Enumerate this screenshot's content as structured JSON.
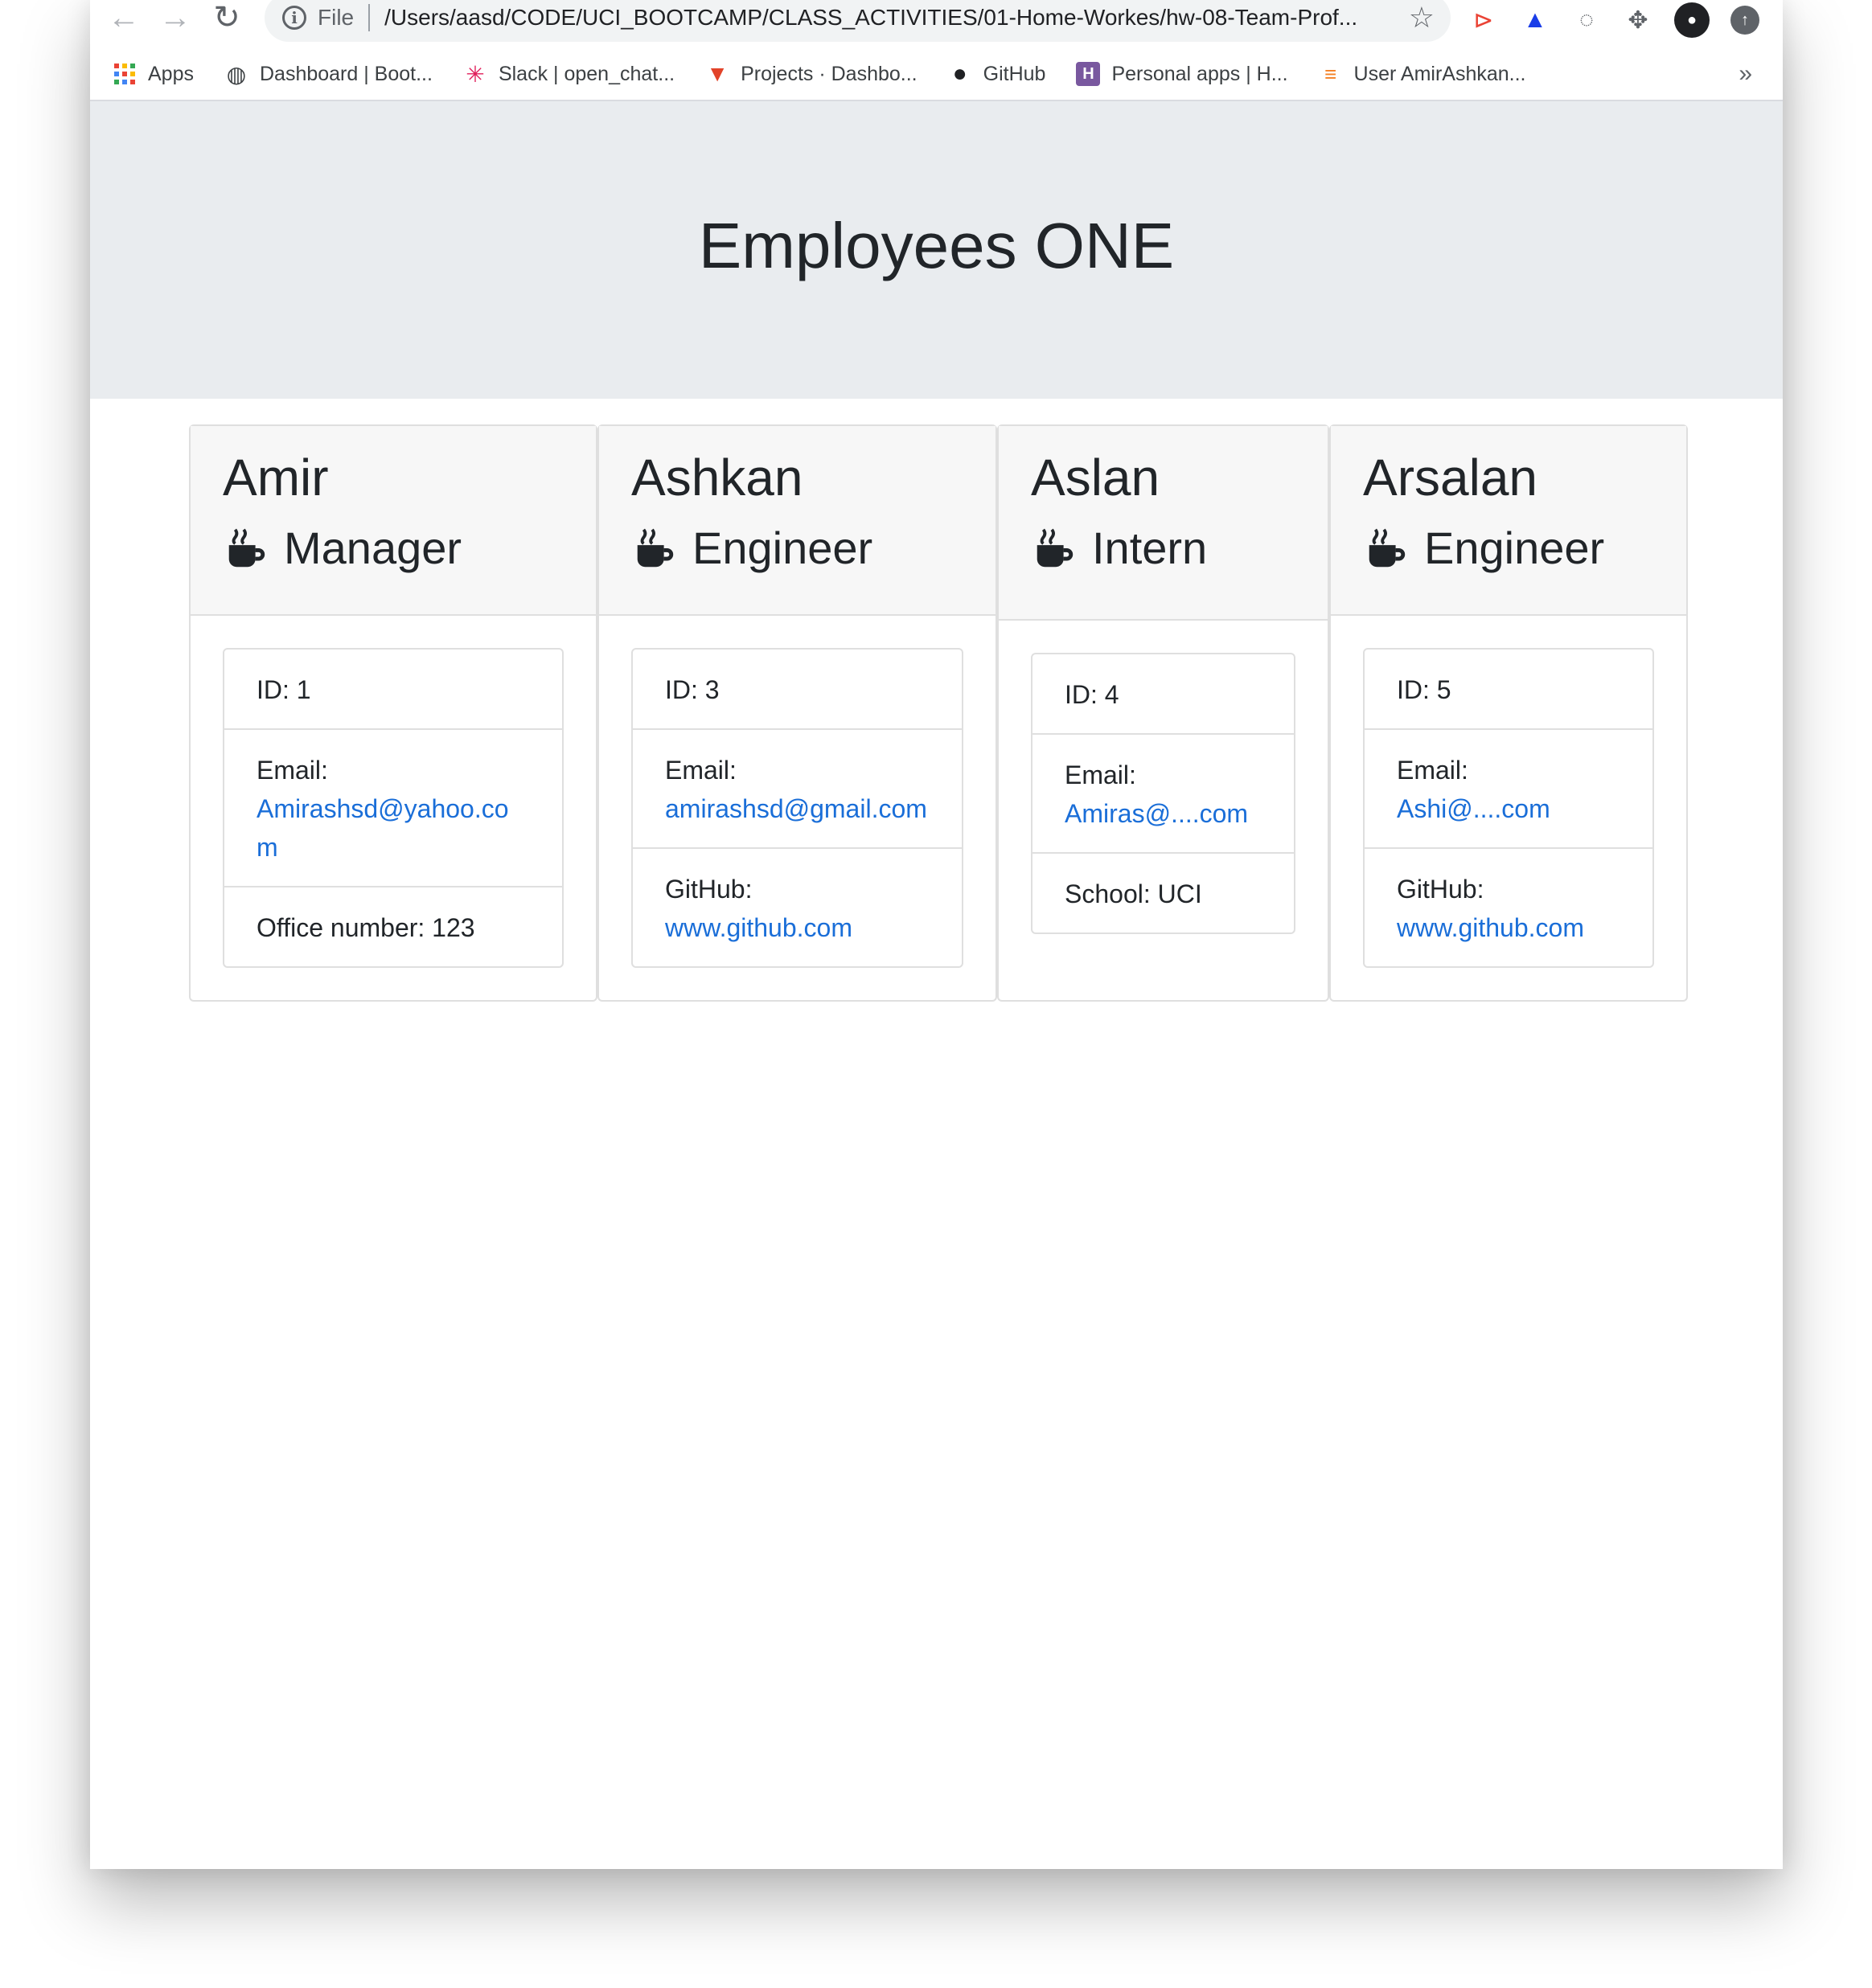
{
  "browser": {
    "file_label": "File",
    "url": "/Users/aasd/CODE/UCI_BOOTCAMP/CLASS_ACTIVITIES/01-Home-Workes/hw-08-Team-Prof...",
    "bookmarks": [
      {
        "label": "Apps",
        "icon": "apps-grid-icon"
      },
      {
        "label": "Dashboard | Boot...",
        "icon": "globe-icon"
      },
      {
        "label": "Slack | open_chat...",
        "icon": "slack-icon"
      },
      {
        "label": "Projects · Dashbo...",
        "icon": "gitlab-icon"
      },
      {
        "label": "GitHub",
        "icon": "github-icon"
      },
      {
        "label": "Personal apps | H...",
        "icon": "heroku-icon"
      },
      {
        "label": "User AmirAshkan...",
        "icon": "stackoverflow-icon"
      }
    ],
    "more_bookmarks": "»"
  },
  "page": {
    "title": "Employees ONE"
  },
  "employees": [
    {
      "name": "Amir",
      "role": "Manager",
      "id_text": "ID: 1",
      "email_label": "Email:",
      "email": "Amirashsd@yahoo.com",
      "extra_label": "Office number: 123",
      "extra_value": ""
    },
    {
      "name": "Ashkan",
      "role": "Engineer",
      "id_text": "ID: 3",
      "email_label": "Email:",
      "email": "amirashsd@gmail.com",
      "extra_label": "GitHub:",
      "extra_value": "www.github.com"
    },
    {
      "name": "Aslan",
      "role": "Intern",
      "id_text": "ID: 4",
      "email_label": "Email:",
      "email": "Amiras@....com",
      "extra_label": "School: UCI",
      "extra_value": ""
    },
    {
      "name": "Arsalan",
      "role": "Engineer",
      "id_text": "ID: 5",
      "email_label": "Email:",
      "email": "Ashi@....com",
      "extra_label": "GitHub:",
      "extra_value": "www.github.com"
    }
  ],
  "colors": {
    "link": "#1a6ed8",
    "jumbotron": "#e9ecef",
    "card_header": "#f7f7f7"
  }
}
